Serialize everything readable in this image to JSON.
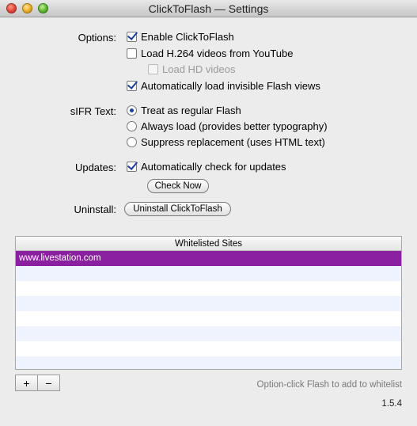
{
  "window": {
    "title": "ClickToFlash — Settings"
  },
  "options": {
    "label": "Options:",
    "enable": {
      "label": "Enable ClickToFlash",
      "checked": true
    },
    "h264": {
      "label": "Load H.264 videos from YouTube",
      "checked": false
    },
    "hd": {
      "label": "Load HD videos",
      "checked": false,
      "disabled": true
    },
    "invisible": {
      "label": "Automatically load invisible Flash views",
      "checked": true
    }
  },
  "sifr": {
    "label": "sIFR Text:",
    "regular": {
      "label": "Treat as regular Flash",
      "selected": true
    },
    "always": {
      "label": "Always load (provides better typography)",
      "selected": false
    },
    "suppress": {
      "label": "Suppress replacement (uses HTML text)",
      "selected": false
    }
  },
  "updates": {
    "label": "Updates:",
    "auto": {
      "label": "Automatically check for updates",
      "checked": true
    },
    "check_now": "Check Now"
  },
  "uninstall": {
    "label": "Uninstall:",
    "button": "Uninstall ClickToFlash"
  },
  "whitelist": {
    "header": "Whitelisted Sites",
    "sites": [
      "www.livestation.com"
    ],
    "selected_index": 0,
    "selection_color": "#8a20a0",
    "add": "+",
    "remove": "−",
    "hint": "Option-click Flash to add to whitelist"
  },
  "version": "1.5.4"
}
